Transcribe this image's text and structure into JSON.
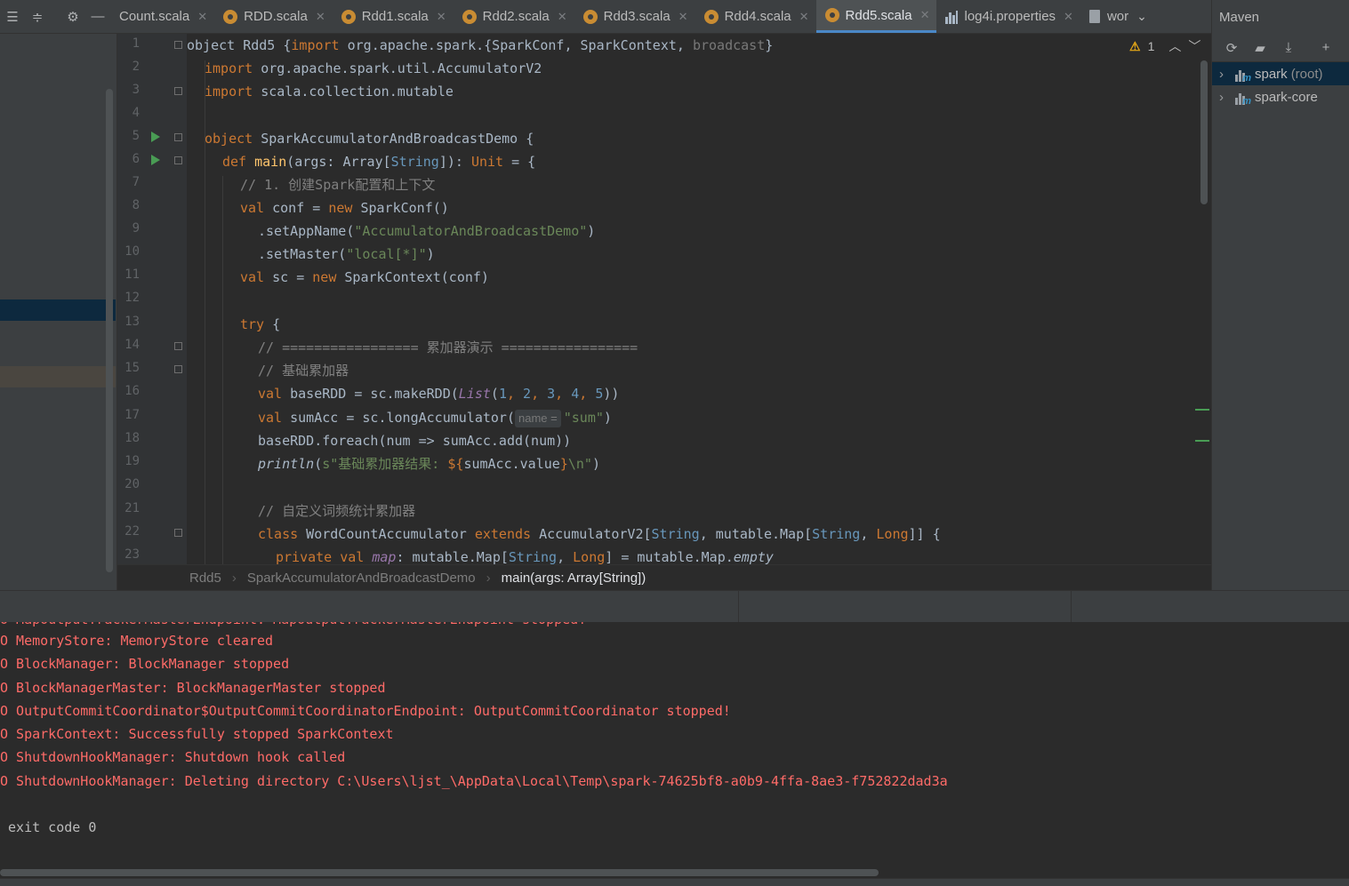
{
  "tabs": [
    {
      "label": "Count.scala",
      "type": "scala"
    },
    {
      "label": "RDD.scala",
      "type": "scala"
    },
    {
      "label": "Rdd1.scala",
      "type": "scala"
    },
    {
      "label": "Rdd2.scala",
      "type": "scala"
    },
    {
      "label": "Rdd3.scala",
      "type": "scala"
    },
    {
      "label": "Rdd4.scala",
      "type": "scala"
    },
    {
      "label": "Rdd5.scala",
      "type": "scala",
      "active": true
    },
    {
      "label": "log4i.properties",
      "type": "properties"
    },
    {
      "label": "wor",
      "type": "doc"
    }
  ],
  "toolbar_icons": [
    "collapse-all-icon",
    "expand-all-icon",
    "gear-icon",
    "minimize-icon"
  ],
  "maven": {
    "title": "Maven",
    "tools": [
      "reload-icon",
      "folder-icon",
      "download-icon",
      "add-icon"
    ],
    "items": [
      {
        "label": "spark",
        "suffix": "(root)"
      },
      {
        "label": "spark-core",
        "suffix": ""
      }
    ]
  },
  "editor": {
    "warnings": "1",
    "lines": [
      {
        "n": "1"
      },
      {
        "n": "2"
      },
      {
        "n": "3"
      },
      {
        "n": "4"
      },
      {
        "n": "5"
      },
      {
        "n": "6"
      },
      {
        "n": "7"
      },
      {
        "n": "8"
      },
      {
        "n": "9"
      },
      {
        "n": "10"
      },
      {
        "n": "11"
      },
      {
        "n": "12"
      },
      {
        "n": "13"
      },
      {
        "n": "14"
      },
      {
        "n": "15"
      },
      {
        "n": "16"
      },
      {
        "n": "17"
      },
      {
        "n": "18"
      },
      {
        "n": "19"
      },
      {
        "n": "20"
      },
      {
        "n": "21"
      },
      {
        "n": "22"
      },
      {
        "n": "23"
      }
    ],
    "code": {
      "l1a": "object Rdd5 {",
      "l1b": "import",
      "l1c": " org.apache.spark.{SparkConf, SparkContext, ",
      "l1d": "broadcast",
      "l1e": "}",
      "l2a": "import",
      "l2b": " org.apache.spark.util.AccumulatorV2",
      "l3a": "import",
      "l3b": " scala.collection.mutable",
      "l5a": "object",
      "l5b": " SparkAccumulatorAndBroadcastDemo {",
      "l6a": "def",
      "l6b": "main",
      "l6c": "(args: Array[",
      "l6d": "String",
      "l6e": "]): ",
      "l6f": "Unit",
      "l6g": " = {",
      "l7": "// 1. 创建Spark配置和上下文",
      "l8a": "val",
      "l8b": " conf = ",
      "l8c": "new",
      "l8d": " SparkConf()",
      "l9a": ".setAppName(",
      "l9b": "\"AccumulatorAndBroadcastDemo\"",
      "l9c": ")",
      "l10a": ".setMaster(",
      "l10b": "\"local[*]\"",
      "l10c": ")",
      "l11a": "val",
      "l11b": " sc = ",
      "l11c": "new",
      "l11d": " SparkContext(conf)",
      "l13a": "try",
      "l13b": " {",
      "l14": "// ================= 累加器演示 =================",
      "l15": "// 基础累加器",
      "l16a": "val",
      "l16b": " baseRDD = sc.makeRDD(",
      "l16c": "List",
      "l16d": "(",
      "l16e": "1",
      "l16f": ", ",
      "l16g": "2",
      "l16h": ", ",
      "l16i": "3",
      "l16j": ", ",
      "l16k": "4",
      "l16l": ", ",
      "l16m": "5",
      "l16n": "))",
      "l17a": "val",
      "l17b": " sumAcc = sc.longAccumulator(",
      "l17hint": "name =",
      "l17c": "\"sum\"",
      "l17d": ")",
      "l18": "baseRDD.foreach(num => sumAcc.add(num))",
      "l19a": "println",
      "l19b": "(",
      "l19c": "s\"基础累加器结果: ",
      "l19d": "${",
      "l19e": "sumAcc.value",
      "l19f": "}",
      "l19g": "\\n\"",
      "l19h": ")",
      "l21": "// 自定义词频统计累加器",
      "l22a": "class",
      "l22b": " WordCountAccumulator ",
      "l22c": "extends",
      "l22d": " AccumulatorV2[",
      "l22e": "String",
      "l22f": ", mutable.Map[",
      "l22g": "String",
      "l22h": ", ",
      "l22i": "Long",
      "l22j": "]] {",
      "l23a": "private val",
      "l23b": "map",
      "l23c": ": mutable.Map[",
      "l23d": "String",
      "l23e": ", ",
      "l23f": "Long",
      "l23g": "] = mutable.Map.",
      "l23h": "empty"
    }
  },
  "breadcrumb": [
    "Rdd5",
    "SparkAccumulatorAndBroadcastDemo",
    "main(args: Array[String])"
  ],
  "console": {
    "lines": [
      "O MapOutputTrackerMasterEndpoint: MapOutputTrackerMasterEndpoint stopped!",
      "O MemoryStore: MemoryStore cleared",
      "O BlockManager: BlockManager stopped",
      "O BlockManagerMaster: BlockManagerMaster stopped",
      "O OutputCommitCoordinator$OutputCommitCoordinatorEndpoint: OutputCommitCoordinator stopped!",
      "O SparkContext: Successfully stopped SparkContext",
      "O ShutdownHookManager: Shutdown hook called",
      "O ShutdownHookManager: Deleting directory C:\\Users\\ljst_\\AppData\\Local\\Temp\\spark-74625bf8-a0b9-4ffa-8ae3-f752822dad3a",
      "",
      " exit code 0"
    ]
  },
  "colors": {
    "keyword": "#cc7832",
    "string": "#6a8759",
    "comment": "#808080",
    "error_output": "#ff6b68",
    "accent": "#4a88c7"
  }
}
